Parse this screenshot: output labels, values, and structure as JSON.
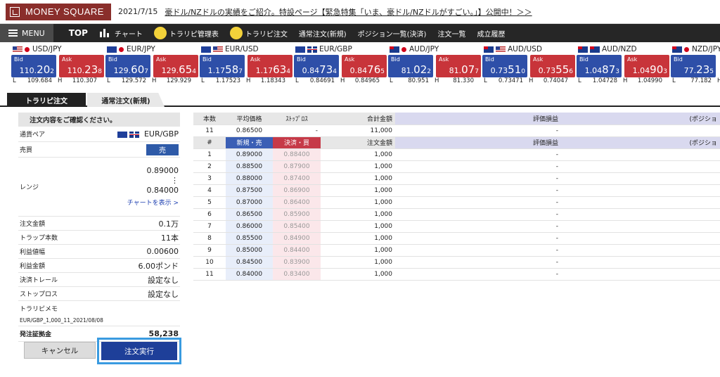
{
  "header": {
    "logo_text": "MONEY SQUARE",
    "news_date": "2021/7/15",
    "news_text": "豪ドル/NZドルの実績をご紹介。特設ページ【緊急特集「いま、豪ドル/NZドルがすごい。」】公開中！＞＞"
  },
  "nav": {
    "menu_label": "MENU",
    "items": [
      "TOP",
      "チャート",
      "トラリピ管理表",
      "トラリピ注文",
      "通常注文(新規)",
      "ポジション一覧(決済)",
      "注文一覧",
      "成立履歴"
    ],
    "icons": [
      "candlestick-icon",
      "character-icon",
      "character-icon"
    ]
  },
  "rates": [
    {
      "pair": "USD/JPY",
      "bid_pre": "110.",
      "bid_big": "20",
      "bid_small": "2",
      "ask_pre": "110.",
      "ask_big": "23",
      "ask_small": "8",
      "low": "109.684",
      "high": "110.307",
      "flags": [
        "us",
        "jp"
      ]
    },
    {
      "pair": "EUR/JPY",
      "bid_pre": "129.",
      "bid_big": "60",
      "bid_small": "7",
      "ask_pre": "129.",
      "ask_big": "65",
      "ask_small": "4",
      "low": "129.572",
      "high": "129.929",
      "flags": [
        "eu",
        "jp"
      ]
    },
    {
      "pair": "EUR/USD",
      "bid_pre": "1.17",
      "bid_big": "58",
      "bid_small": "7",
      "ask_pre": "1.17",
      "ask_big": "63",
      "ask_small": "4",
      "low": "1.17523",
      "high": "1.18343",
      "flags": [
        "eu",
        "us"
      ]
    },
    {
      "pair": "EUR/GBP",
      "bid_pre": "0.84",
      "bid_big": "73",
      "bid_small": "4",
      "ask_pre": "0.84",
      "ask_big": "76",
      "ask_small": "5",
      "low": "0.84691",
      "high": "0.84965",
      "flags": [
        "eu",
        "gb"
      ]
    },
    {
      "pair": "AUD/JPY",
      "bid_pre": "81.",
      "bid_big": "02",
      "bid_small": "2",
      "ask_pre": "81.",
      "ask_big": "07",
      "ask_small": "7",
      "low": "80.951",
      "high": "81.330",
      "flags": [
        "au",
        "jp"
      ]
    },
    {
      "pair": "AUD/USD",
      "bid_pre": "0.73",
      "bid_big": "51",
      "bid_small": "0",
      "ask_pre": "0.73",
      "ask_big": "55",
      "ask_small": "6",
      "low": "0.73471",
      "high": "0.74047",
      "flags": [
        "au",
        "us"
      ]
    },
    {
      "pair": "AUD/NZD",
      "bid_pre": "1.04",
      "bid_big": "87",
      "bid_small": "3",
      "ask_pre": "1.04",
      "ask_big": "90",
      "ask_small": "3",
      "low": "1.04728",
      "high": "1.04990",
      "flags": [
        "au",
        "nz"
      ]
    },
    {
      "pair": "NZD/JPY",
      "bid_pre": "77.",
      "bid_big": "23",
      "bid_small": "5",
      "ask_pre": "",
      "ask_big": "",
      "ask_small": "",
      "low": "77.182",
      "high": "",
      "flags": [
        "nz",
        "jp"
      ]
    }
  ],
  "quote_labels": {
    "bid": "Bid",
    "ask": "Ask",
    "low": "L",
    "high": "H"
  },
  "tabs": [
    "トラリピ注文",
    "通常注文(新規)"
  ],
  "confirm": {
    "title": "注文内容をご確認ください。",
    "pair_label": "通貨ペア",
    "pair_value": "EUR/GBP",
    "side_label": "売買",
    "side_value": "売",
    "range_label": "レンジ",
    "range_top": "0.89000",
    "range_sep": "⋮",
    "range_bottom": "0.84000",
    "chart_link": "チャートを表示 >",
    "rows": [
      {
        "k": "注文金額",
        "v": "0.1万"
      },
      {
        "k": "トラップ本数",
        "v": "11本"
      },
      {
        "k": "利益値幅",
        "v": "0.00600"
      },
      {
        "k": "利益金額",
        "v": "6.00ポンド"
      },
      {
        "k": "決済トレール",
        "v": "設定なし"
      },
      {
        "k": "ストップロス",
        "v": "設定なし"
      }
    ],
    "memo_label": "トラリピメモ",
    "memo_value": "EUR/GBP_1,000_11_2021/08/08",
    "margin_label": "発注証拠金",
    "margin_value": "58,238",
    "cancel_label": "キャンセル",
    "execute_label": "注文実行"
  },
  "summary_table": {
    "headers": [
      "本数",
      "平均価格",
      "ｽﾄｯﾌﾟﾛｽ",
      "合計金額",
      "評価損益",
      "(ポジショ"
    ],
    "row": [
      "11",
      "0.86500",
      "-",
      "11,000",
      "-",
      ""
    ]
  },
  "detail_table": {
    "headers": [
      "#",
      "新規・売",
      "決済・買",
      "注文金額",
      "評価損益",
      "(ポジショ"
    ],
    "rows": [
      [
        "1",
        "0.89000",
        "0.88400",
        "1,000",
        "-"
      ],
      [
        "2",
        "0.88500",
        "0.87900",
        "1,000",
        "-"
      ],
      [
        "3",
        "0.88000",
        "0.87400",
        "1,000",
        "-"
      ],
      [
        "4",
        "0.87500",
        "0.86900",
        "1,000",
        "-"
      ],
      [
        "5",
        "0.87000",
        "0.86400",
        "1,000",
        "-"
      ],
      [
        "6",
        "0.86500",
        "0.85900",
        "1,000",
        "-"
      ],
      [
        "7",
        "0.86000",
        "0.85400",
        "1,000",
        "-"
      ],
      [
        "8",
        "0.85500",
        "0.84900",
        "1,000",
        "-"
      ],
      [
        "9",
        "0.85000",
        "0.84400",
        "1,000",
        "-"
      ],
      [
        "10",
        "0.84500",
        "0.83900",
        "1,000",
        "-"
      ],
      [
        "11",
        "0.84000",
        "0.83400",
        "1,000",
        "-"
      ]
    ]
  },
  "colors": {
    "brand": "#8a2e2b",
    "bid": "#2e4fa8",
    "ask": "#c8343a",
    "highlight": "#3a9be0"
  }
}
